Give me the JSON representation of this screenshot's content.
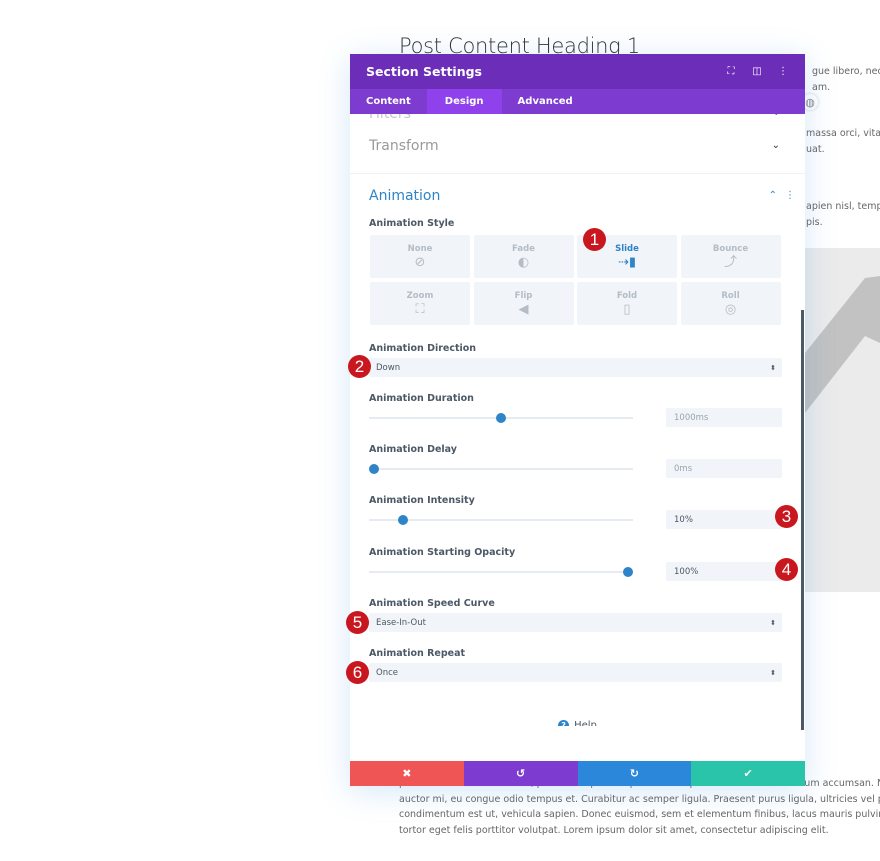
{
  "background": {
    "heading": "Post Content Heading 1",
    "right_lines": [
      "gue libero, nec fin",
      "am.",
      "massa orci, vitae la",
      "uat.",
      "apien nisl, tempus",
      "pis."
    ],
    "bottom_lines": [
      "posuere nec lectus sit amet, pulvinar dapibus sapien. Donec placerat erat at fermentum accumsan. Nunc in sceleris",
      "auctor mi, eu congue odio tempus et. Curabitur ac semper ligula. Praesent purus ligula, ultricies vel porta ac, elemer",
      "condimentum est ut, vehicula sapien. Donec euismod, sem et elementum finibus, lacus mauris pulvinar enim, nec fa",
      "tortor eget felis porttitor volutpat. Lorem ipsum dolor sit amet, consectetur adipiscing elit."
    ]
  },
  "modal": {
    "title": "Section Settings",
    "header_icons": [
      "expand-icon",
      "sidebar-layout-icon",
      "more-vertical-icon"
    ],
    "tabs": [
      {
        "label": "Content",
        "active": false
      },
      {
        "label": "Design",
        "active": true
      },
      {
        "label": "Advanced",
        "active": false
      }
    ],
    "sections": {
      "filters": "Filters",
      "transform": "Transform",
      "animation": "Animation"
    },
    "animation_style": {
      "label": "Animation Style",
      "options": [
        {
          "name": "None",
          "icon": "⊘",
          "active": false
        },
        {
          "name": "Fade",
          "icon": "◐",
          "active": false
        },
        {
          "name": "Slide",
          "icon": "⇢▮",
          "active": true
        },
        {
          "name": "Bounce",
          "icon": "⤴",
          "active": false
        },
        {
          "name": "Zoom",
          "icon": "⛶",
          "active": false
        },
        {
          "name": "Flip",
          "icon": "◀",
          "active": false
        },
        {
          "name": "Fold",
          "icon": "▯",
          "active": false
        },
        {
          "name": "Roll",
          "icon": "◎",
          "active": false
        }
      ]
    },
    "direction": {
      "label": "Animation Direction",
      "value": "Down"
    },
    "duration": {
      "label": "Animation Duration",
      "value": "1000ms",
      "slider_fraction": 0.5
    },
    "delay": {
      "label": "Animation Delay",
      "value": "0ms",
      "slider_fraction": 0.0
    },
    "intensity": {
      "label": "Animation Intensity",
      "value": "10%",
      "slider_fraction": 0.115
    },
    "opacity": {
      "label": "Animation Starting Opacity",
      "value": "100%",
      "slider_fraction": 1.0
    },
    "speed_curve": {
      "label": "Animation Speed Curve",
      "value": "Ease-In-Out"
    },
    "repeat": {
      "label": "Animation Repeat",
      "value": "Once"
    },
    "help_label": "Help",
    "footer": {
      "cancel": {
        "icon": "✖",
        "color": "#ef5555"
      },
      "undo": {
        "icon": "↺",
        "color": "#7e3bd0"
      },
      "redo": {
        "icon": "↻",
        "color": "#2b87da"
      },
      "save": {
        "icon": "✔",
        "color": "#29c4a9"
      }
    }
  },
  "annotations": [
    "1",
    "2",
    "3",
    "4",
    "5",
    "6"
  ]
}
